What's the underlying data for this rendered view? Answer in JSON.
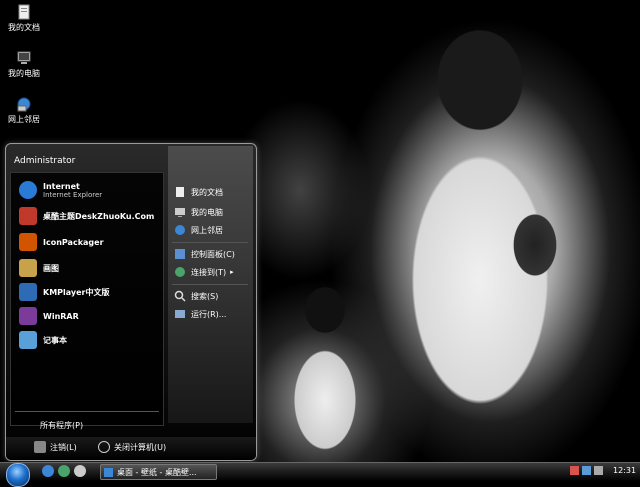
{
  "desktop": {
    "icons": [
      {
        "label": "我的文档",
        "icon": "my-documents-icon"
      },
      {
        "label": "我的电脑",
        "icon": "my-computer-icon"
      },
      {
        "label": "网上邻居",
        "icon": "network-icon"
      }
    ]
  },
  "start_menu": {
    "user": "Administrator",
    "programs": [
      {
        "name": "Internet",
        "sub": "Internet Explorer",
        "icon": "ie-icon",
        "color": "#2a7bd6"
      },
      {
        "name": "桌酷主题DeskZhuoKu.Com",
        "sub": "",
        "icon": "deskzhuoku-icon",
        "color": "#c0392b"
      },
      {
        "name": "IconPackager",
        "sub": "",
        "icon": "iconpackager-icon",
        "color": "#d35400"
      },
      {
        "name": "画图",
        "sub": "",
        "icon": "paint-icon",
        "color": "#c8a24a"
      },
      {
        "name": "KMPlayer中文版",
        "sub": "",
        "icon": "kmplayer-icon",
        "color": "#2e6bb5"
      },
      {
        "name": "WinRAR",
        "sub": "",
        "icon": "winrar-icon",
        "color": "#7a3b9a"
      },
      {
        "name": "记事本",
        "sub": "",
        "icon": "notepad-icon",
        "color": "#5aa0d8"
      }
    ],
    "all_programs": "所有程序(P)",
    "places": [
      {
        "label": "我的文档",
        "icon": "my-documents-icon"
      },
      {
        "label": "我的电脑",
        "icon": "my-computer-icon"
      },
      {
        "label": "网上邻居",
        "icon": "network-icon"
      },
      {
        "label": "控制面板(C)",
        "icon": "control-panel-icon"
      },
      {
        "label": "连接到(T)",
        "icon": "connect-to-icon"
      },
      {
        "label": "搜索(S)",
        "icon": "search-icon"
      },
      {
        "label": "运行(R)...",
        "icon": "run-icon"
      }
    ],
    "logoff": "注销(L)",
    "shutdown": "关闭计算机(U)"
  },
  "taskbar": {
    "task_label": "桌面 - 壁纸 - 桌酷壁...",
    "clock": "12:31"
  },
  "colors": {
    "accent": "#1c6fcc"
  }
}
